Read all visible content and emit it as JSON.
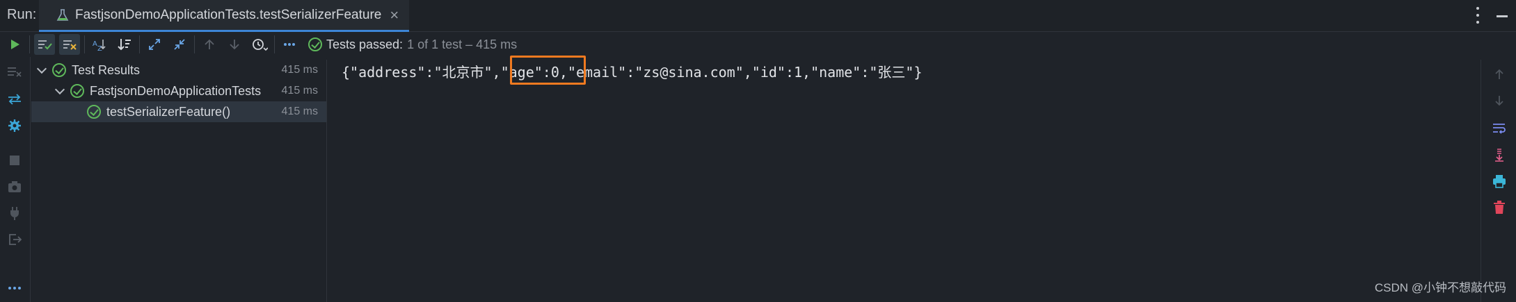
{
  "header": {
    "run_label": "Run:",
    "tab_title": "FastjsonDemoApplicationTests.testSerializerFeature",
    "close_glyph": "×"
  },
  "toolbar": {
    "status_label": "Tests passed:",
    "status_count": "1 of 1 test – 415 ms",
    "icons": [
      "play-icon",
      "show-passed-icon",
      "show-ignored-icon",
      "sort-alpha-icon",
      "sort-duration-icon",
      "expand-all-icon",
      "collapse-all-icon",
      "prev-failed-icon",
      "next-failed-icon",
      "history-icon",
      "more-icon",
      "tests-passed-icon"
    ]
  },
  "tree": {
    "rows": [
      {
        "label": "Test Results",
        "time": "415 ms"
      },
      {
        "label": "FastjsonDemoApplicationTests",
        "time": "415 ms"
      },
      {
        "label": "testSerializerFeature()",
        "time": "415 ms"
      }
    ]
  },
  "console": {
    "output": "{\"address\":\"北京市\",\"age\":0,\"email\":\"zs@sina.com\",\"id\":1,\"name\":\"张三\"}"
  },
  "watermark": "CSDN @小钟不想敲代码",
  "colors": {
    "accent_blue": "#3d85d6",
    "pass_green": "#5fb85b",
    "highlight_orange": "#f07a20",
    "background": "#1f2329"
  }
}
